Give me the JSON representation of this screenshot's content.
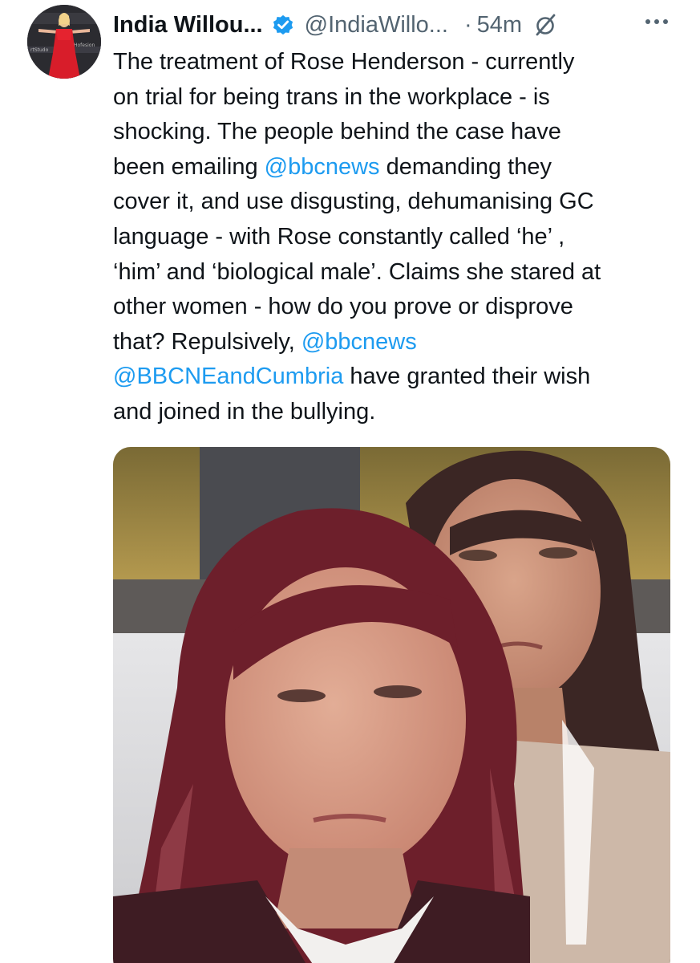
{
  "tweet": {
    "author": {
      "display_name": "India Willou...",
      "handle": "@IndiaWillo...",
      "verified": true,
      "avatar_icon": "profile-avatar"
    },
    "separator": "·",
    "time": "54m",
    "grok_icon": "grok-icon",
    "more_icon": "more-options-icon",
    "text": {
      "line1": "The treatment of Rose Henderson - currently",
      "line2": "on trial for being trans in the workplace - is",
      "line3": "shocking. The people behind the case have",
      "line4_a": "been emailing ",
      "line4_mention": "@bbcnews",
      "line4_b": " demanding they",
      "line5": "cover it, and use disgusting, dehumanising GC",
      "line6": "language - with Rose constantly called ‘he’ ,",
      "line7": "‘him’ and ‘biological male’. Claims she stared at",
      "line8": "other women - how do you prove or disprove",
      "line9_a": "that? Repulsively, ",
      "line9_mention": "@bbcnews",
      "line10_mention": "@BBCNEandCumbria",
      "line10_b": " have granted their wish",
      "line11": "and joined in the bullying."
    },
    "media": {
      "type": "photo",
      "icon": "photo-two-women"
    },
    "colors": {
      "link": "#1d9bf0",
      "secondary": "#536471",
      "verified": "#1d9bf0"
    }
  }
}
